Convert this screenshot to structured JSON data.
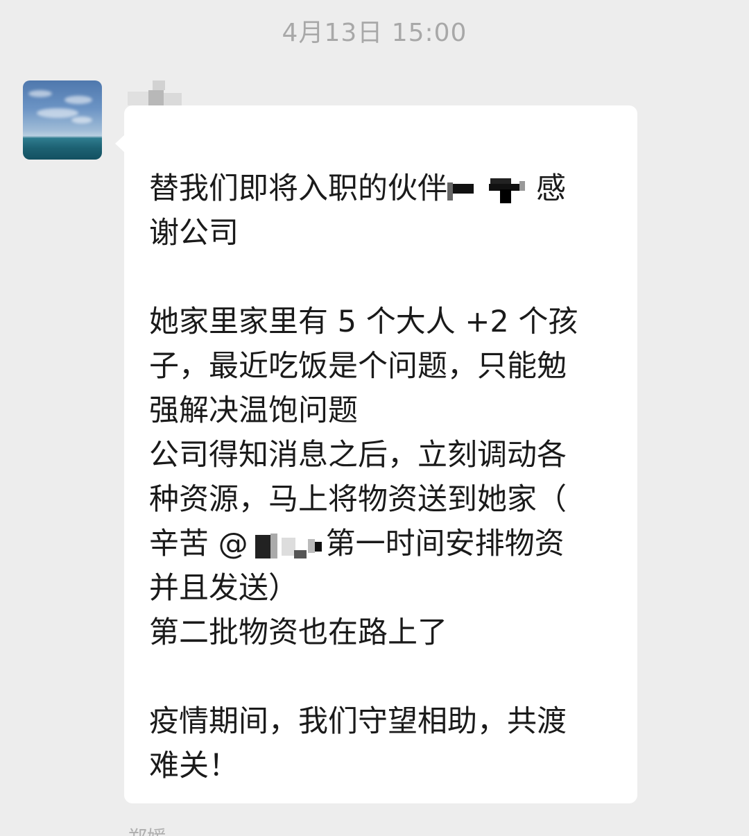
{
  "chat": {
    "timestamp": "4月13日 15:00",
    "message": {
      "sender_name": "[redacted]",
      "avatar": "sea-horizon-avatar",
      "p1": {
        "l1_before": "替我们即将入职的伙伴",
        "l1_after": "感",
        "l2": "谢公司"
      },
      "p2": {
        "l1": "她家里家里有 5 个大人 +2 个孩",
        "l2": "子，最近吃饭是个问题，只能勉",
        "l3": "强解决温饱问题",
        "l4": "公司得知消息之后，立刻调动各",
        "l5": "种资源，马上将物资送到她家（",
        "l6_before": "辛苦 @",
        "l6_after": "第一时间安排物资",
        "l7": "并且发送）",
        "l8": "第二批物资也在路上了"
      },
      "p3": {
        "l1": "疫情期间，我们守望相助，共渡",
        "l2": "难关！"
      }
    },
    "next_sender_name": "郑媛"
  },
  "colors": {
    "background": "#ededed",
    "bubble": "#ffffff",
    "text": "#1a1a1a",
    "timestamp": "#a8a8a8"
  }
}
